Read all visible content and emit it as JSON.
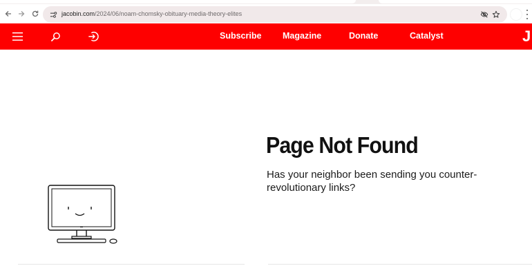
{
  "browser": {
    "url_host": "jacobin.com",
    "url_path": "/2024/06/noam-chomsky-obituary-media-theory-elites",
    "icons": [
      "back-arrow-icon",
      "forward-arrow-icon",
      "reload-icon",
      "site-info-icon",
      "eye-off-icon",
      "star-icon",
      "profile-avatar",
      "kebab-menu-icon"
    ]
  },
  "header": {
    "background_color": "#fe0000",
    "nav": {
      "subscribe": "Subscribe",
      "magazine": "Magazine",
      "donate": "Donate",
      "catalyst": "Catalyst"
    },
    "logo_text": "J",
    "icons": [
      "hamburger-menu-icon",
      "search-icon",
      "login-icon"
    ]
  },
  "main": {
    "title": "Page Not Found",
    "message": "Has your neighbor been sending you counter-revolutionary links?",
    "illustration": "smiling-computer-icon"
  }
}
